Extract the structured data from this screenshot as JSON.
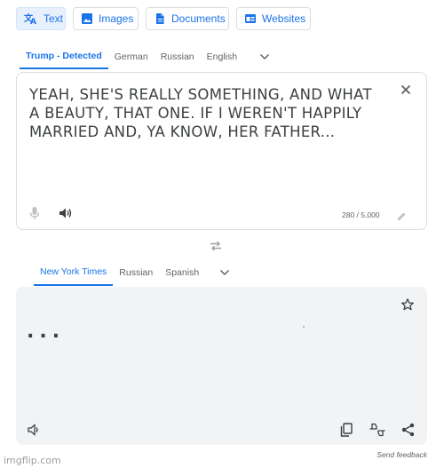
{
  "mode_tabs": [
    {
      "label": "Text",
      "icon": "translate-icon",
      "active": true
    },
    {
      "label": "Images",
      "icon": "image-icon",
      "active": false
    },
    {
      "label": "Documents",
      "icon": "document-icon",
      "active": false
    },
    {
      "label": "Websites",
      "icon": "website-icon",
      "active": false
    }
  ],
  "source_languages": [
    "Trump - Detected",
    "German",
    "Russian",
    "English"
  ],
  "target_languages": [
    "New York Times",
    "Russian",
    "Spanish"
  ],
  "source": {
    "text": "YEAH, SHE'S REALLY SOMETHING, AND WHAT A BEAUTY, THAT ONE. IF I WEREN'T HAPPILY MARRIED AND, YA KNOW, HER FATHER...",
    "char_count": "280 / 5,000"
  },
  "target": {
    "text": "..."
  },
  "footer": {
    "feedback": "Send feedback",
    "watermark": "imgflip.com"
  },
  "colors": {
    "accent": "#1a73e8",
    "active_tab_bg": "#e8f0fe",
    "target_bg": "#f1f3f4",
    "text": "#3c4043",
    "muted": "#5f6368"
  }
}
